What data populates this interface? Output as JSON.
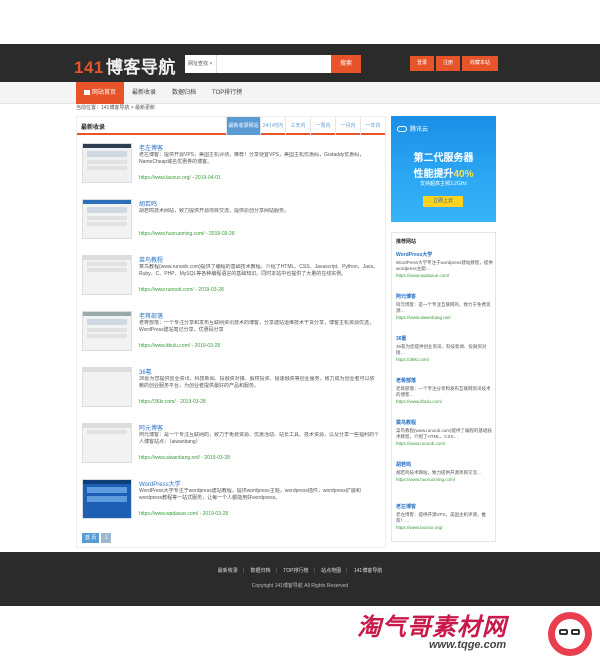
{
  "header": {
    "logo_num": "141",
    "logo_text": "博客导航",
    "search_select": "网址查找 ×",
    "search_placeholder": "",
    "search_button": "搜索",
    "buttons": [
      "登录",
      "注册",
      "收藏本站"
    ]
  },
  "nav": {
    "items": [
      "网站首页",
      "最新收录",
      "数据归档",
      "TOP排行榜"
    ]
  },
  "breadcrumb": "当前位置：141博客导航 > 最新更新",
  "main": {
    "title": "最新收录",
    "tabs": [
      "最新收录网站",
      "24小时内",
      "三天内",
      "一周内",
      "一月内",
      "一年内"
    ],
    "items": [
      {
        "title": "老左博客",
        "desc": "老左博客：提供开源VPS，美国主机评测，推荐！分享便宜VPS，美国主机优惠码，Godaddy优惠码，NameCheap域名优惠券的博客。",
        "url": "https://www.laozuo.org/ - 2019-04-01"
      },
      {
        "title": "胡若鸣",
        "desc": "胡若鸣技术网站，致力提供开源项目交流，提供原创分享网站服务。",
        "url": "https://www.huoruoming.com/ - 2019-03-28"
      },
      {
        "title": "菜鸟教程",
        "desc": "菜鸟教程(www.runoob.com)提供了编程的基础技术教程，介绍了HTML、CSS、Javascript、Python、Java、Ruby、C、PHP、MySQL等各种编程语言的基础知识。同时本站中也提供了大量的在线实例。",
        "url": "https://www.runoob.com/ - 2019-03-28"
      },
      {
        "title": "老蒋部落",
        "desc": "老蒋部落：一个专注分享和发布互联网资讯技术的博客，分享建站运维技术干货分享，博客主机资源优选，WordPress建站笔记分享，优惠码分享",
        "url": "https://www.itbulu.com/ - 2019-03-28"
      },
      {
        "title": "36氪",
        "desc": "36氪为您提供创业资讯、科技新闻、投融资对接、股权投资、极速融资等创业服务，致力成为创业者可以依赖的创业服务平台，为创业者提供最好的产品和服务。",
        "url": "https://36kr.com/ - 2019-03-28"
      },
      {
        "title": "阿元博客",
        "desc": "阿元博客：是一个专注互联网的，致力于免费资源、优惠活动、站长工具、技术资源，以及分享一些福利的个人博客站点：（aiwanbang）",
        "url": "https://www.aiwanbang.net/ - 2019-03-28"
      },
      {
        "title": "WordPress大学",
        "desc": "WordPress大学专注于wordpress建站教程，提供wordpress主题，wordpress插件，wordpress扩展和wordpress教程等一站式服务，让每一个人都能用好wordpress。",
        "url": "https://www.wpdaxue.com/ - 2019-03-28"
      }
    ],
    "pager": [
      "首 页",
      "1"
    ]
  },
  "sidebar": {
    "ad": {
      "brand": "腾讯云",
      "line1": "第二代服务器",
      "line2_prefix": "性能提升",
      "line2_highlight": "40%",
      "line3": "支持超高主频3.2GHz",
      "button": "立即上云"
    },
    "rec_title": "推荐网站",
    "rec": [
      {
        "name": "WordPress大学",
        "desc": "WordPress大学专注于wordpress建站教程，提供wordpress主题…",
        "url": "https://www.wpdaxue.com/"
      },
      {
        "name": "阿元博客",
        "desc": "阿元博客：是一个专注互联网的，致力于免费资源…",
        "url": "https://www.aiwanbang.net/"
      },
      {
        "name": "36氪",
        "desc": "36氪为您提供创业资讯、科技新闻、投融资对接…",
        "url": "https://36kr.com/"
      },
      {
        "name": "老蒋部落",
        "desc": "老蒋部落：一个专注分享和发布互联网资讯技术的博客…",
        "url": "https://www.itbulu.com/"
      },
      {
        "name": "菜鸟教程",
        "desc": "菜鸟教程(www.runoob.com)提供了编程的基础技术教程，介绍了HTML、CSS…",
        "url": "https://www.runoob.com/"
      },
      {
        "name": "胡若鸣",
        "desc": "胡若鸣技术网站，致力提供开源项目交流…",
        "url": "https://www.huoruoming.com/"
      },
      {
        "name": "老左博客",
        "desc": "老左博客：提供开源VPS，美国主机评测，推荐！…",
        "url": "https://www.laozuo.org/"
      }
    ]
  },
  "footer": {
    "links": [
      "最新收录",
      "数据归档",
      "TOP排行榜",
      "站点地图",
      "141博客导航"
    ],
    "copyright": "Copyright 141博客导航 All Rights Reserved"
  },
  "watermark": {
    "title": "淘气哥素材网",
    "url": "www.tqge.com"
  },
  "colors": {
    "accent": "#e8542a",
    "link": "#2a72c2",
    "url_green": "#3a9a3a",
    "tab_blue": "#5b9bd5",
    "dark_bg": "#2b2b2b"
  }
}
